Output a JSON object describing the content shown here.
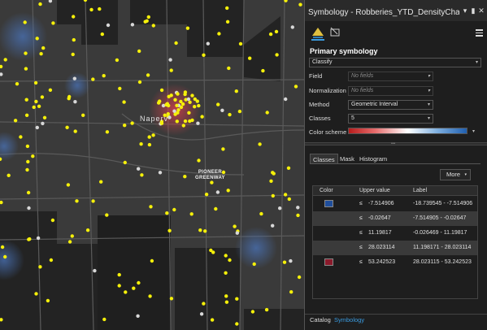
{
  "map": {
    "city_label": "Naperv",
    "place_label_line1": "PIONEER",
    "place_label_line2": "GREENWAY"
  },
  "panel": {
    "title": "Symbology - Robberies_YTD_DensityCha...",
    "primary_symbology_heading": "Primary symbology",
    "renderer_value": "Classify",
    "field_label": "Field",
    "field_placeholder": "No fields",
    "normalization_label": "Normalization",
    "normalization_placeholder": "No fields",
    "method_label": "Method",
    "method_value": "Geometric Interval",
    "classes_label": "Classes",
    "classes_value": "5",
    "color_scheme_label": "Color scheme",
    "tabs": [
      "Classes",
      "Mask",
      "Histogram"
    ],
    "more_label": "More",
    "table": {
      "headers": [
        "Color",
        "Upper value",
        "Label"
      ],
      "rows": [
        {
          "color": "#1f4e9c",
          "op": "≤",
          "upper": "-7.514906",
          "label": "-18.739545 - -7.514906"
        },
        {
          "color": "",
          "op": "≤",
          "upper": "-0.02647",
          "label": "-7.514905 - -0.02647"
        },
        {
          "color": "",
          "op": "≤",
          "upper": "11.19817",
          "label": "-0.026469 - 11.19817"
        },
        {
          "color": "",
          "op": "≤",
          "upper": "28.023114",
          "label": "11.198171 - 28.023114"
        },
        {
          "color": "#8b1a2b",
          "op": "≤",
          "upper": "53.242523",
          "label": "28.023115 - 53.242523"
        }
      ]
    },
    "bottom_tabs": [
      "Catalog",
      "Symbology"
    ]
  },
  "colors": {
    "accent": "#3a9be0",
    "dot": "#f5f00a",
    "hotspot": "#d0404a",
    "coldspot": "#4a73b8"
  }
}
